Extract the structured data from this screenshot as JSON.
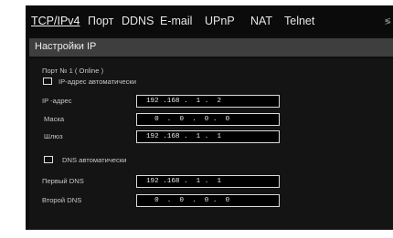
{
  "tabs": [
    {
      "label": "TCP/IPv4",
      "active": true
    },
    {
      "label": "Порт",
      "active": false
    },
    {
      "label": "DDNS",
      "active": false
    },
    {
      "label": "E-mail",
      "active": false
    },
    {
      "label": "UPnP",
      "active": false
    },
    {
      "label": "NAT",
      "active": false
    },
    {
      "label": "Telnet",
      "active": false
    }
  ],
  "tab_scroll_glyph": "≶",
  "section_title": "Настройки IP",
  "port_label": "Порт № 1 ( Online )",
  "ip_auto": {
    "label": "IP-адрес автоматически",
    "checked": false
  },
  "fields": {
    "ip": {
      "label": "IP -адрес",
      "value": "192 .168 .  1 .  2"
    },
    "mask": {
      "label": "Маска",
      "value": "  0  .  0  .  0 .  0"
    },
    "gateway": {
      "label": "Шлюз",
      "value": "192 .168 .  1 .  1"
    }
  },
  "dns_auto": {
    "label": "DNS автоматически",
    "checked": false
  },
  "dns": {
    "primary": {
      "label": "Первый DNS",
      "value": "192 .168 .  1 .  1"
    },
    "secondary": {
      "label": "Второй DNS",
      "value": "  0  .  0  .  0 .  0"
    }
  }
}
